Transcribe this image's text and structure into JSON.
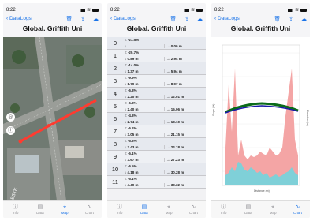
{
  "status": {
    "time": "8:22"
  },
  "nav": {
    "back_label": "DataLogs"
  },
  "title": "Global. Griffith Uni",
  "map_text": {
    "compass": "ESTE"
  },
  "tabs": [
    {
      "label": "Info",
      "icon": "info-icon"
    },
    {
      "label": "Data",
      "icon": "data-icon"
    },
    {
      "label": "Map",
      "icon": "map-icon"
    },
    {
      "label": "Chart",
      "icon": "chart-icon"
    }
  ],
  "rows": [
    {
      "index": "0",
      "a1": "-21.5%",
      "a2": "",
      "b1": "",
      "b2": "0.00 m"
    },
    {
      "index": "1",
      "a1": "-20.7%",
      "a2": "0.89 m",
      "b1": "",
      "b2": "2.94 m"
    },
    {
      "index": "2",
      "a1": "-14.0%",
      "a2": "1.37 m",
      "b1": "",
      "b2": "5.94 m"
    },
    {
      "index": "3",
      "a1": "-9.9%",
      "a2": "1.79 m",
      "b1": "",
      "b2": "8.97 m"
    },
    {
      "index": "4",
      "a1": "-6.8%",
      "a2": "2.20 m",
      "b1": "",
      "b2": "12.01 m"
    },
    {
      "index": "5",
      "a1": "-5.8%",
      "a2": "2.40 m",
      "b1": "",
      "b2": "15.06 m"
    },
    {
      "index": "6",
      "a1": "-4.8%",
      "a2": "2.74 m",
      "b1": "",
      "b2": "18.10 m"
    },
    {
      "index": "7",
      "a1": "-5.2%",
      "a2": "3.05 m",
      "b1": "",
      "b2": "21.15 m"
    },
    {
      "index": "8",
      "a1": "-5.3%",
      "a2": "3.43 m",
      "b1": "",
      "b2": "24.18 m"
    },
    {
      "index": "9",
      "a1": "-5.1%",
      "a2": "3.67 m",
      "b1": "",
      "b2": "27.23 m"
    },
    {
      "index": "10",
      "a1": "-6.5%",
      "a2": "4.18 m",
      "b1": "",
      "b2": "30.28 m"
    },
    {
      "index": "11",
      "a1": "-5.1%",
      "a2": "4.40 m",
      "b1": "",
      "b2": "33.32 m"
    }
  ],
  "chart": {
    "y_left_label": "Slope (%)",
    "y_right_label": "Elevation (m)",
    "x_label": "Distance (m)"
  },
  "colors": {
    "accent": "#1a73e8",
    "fill_red": "#f4a5a5",
    "fill_teal": "#7fd0d8"
  }
}
